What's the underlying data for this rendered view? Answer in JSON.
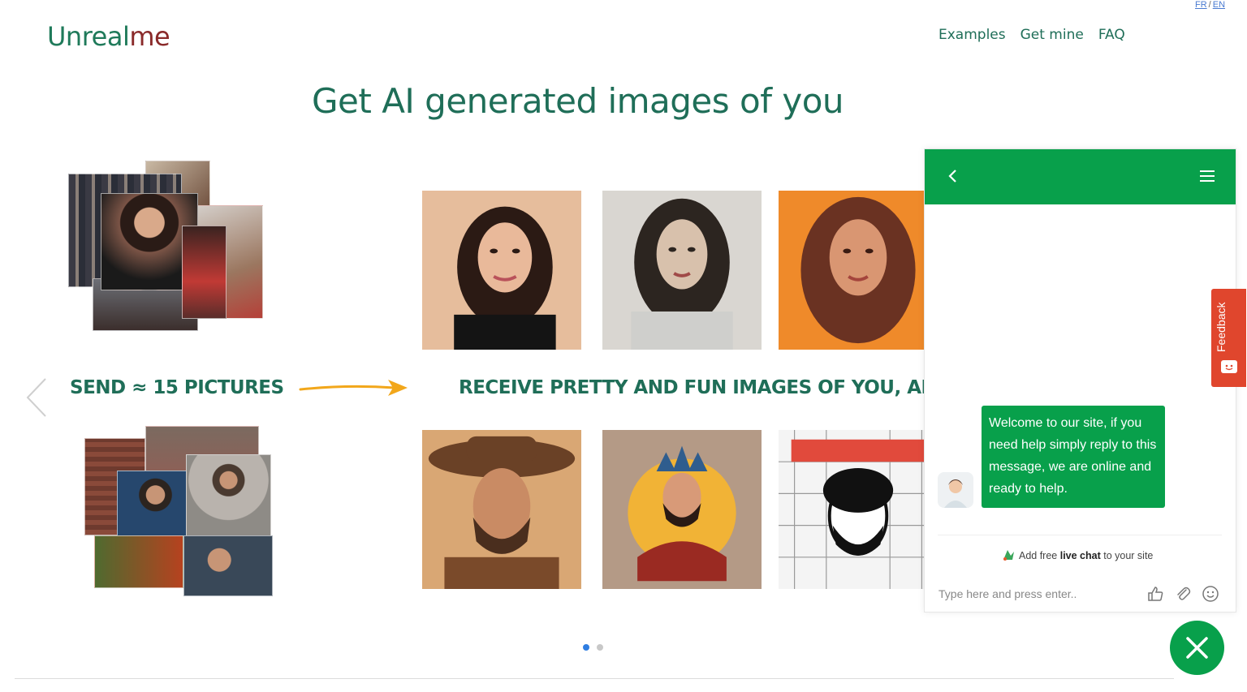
{
  "lang": {
    "fr": "FR",
    "sep": "/",
    "en": "EN"
  },
  "brand": {
    "part1": "Unreal",
    "part2": "me"
  },
  "nav": [
    "Examples",
    "Get mine",
    "FAQ"
  ],
  "hero": {
    "title": "Get AI generated images of you"
  },
  "carousel": {
    "send_label": "SEND ≈ 15 PICTURES",
    "receive_label": "RECEIVE PRETTY AND FUN IMAGES OF YOU, ARTIF",
    "dots": [
      true,
      false
    ]
  },
  "chat": {
    "welcome": "Welcome to our site, if you need help simply reply to this message, we are online and ready to help.",
    "powered_pre": "Add free ",
    "powered_bold": "live chat",
    "powered_post": " to your site",
    "placeholder": "Type here and press enter.."
  },
  "feedback": {
    "label": "Feedback"
  },
  "colors": {
    "brand_green": "#1f6e58",
    "chat_green": "#08a04b",
    "feedback_red": "#e0462d",
    "accent_orange": "#f2a71b"
  },
  "icons": [
    "chevron-left-icon",
    "arrow-right-icon",
    "back-icon",
    "menu-icon",
    "thumbs-up-icon",
    "paperclip-icon",
    "smiley-icon",
    "close-icon",
    "feedback-icon"
  ]
}
